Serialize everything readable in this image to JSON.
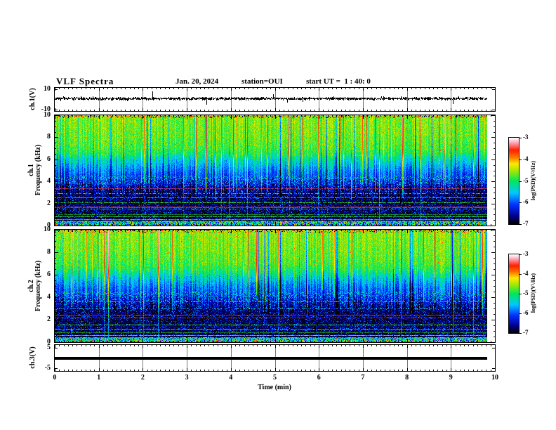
{
  "header": {
    "title": "VLF Spectra",
    "date": "Jan. 20, 2024",
    "station": "station=OUI",
    "start_ut": "start UT =  1 : 40: 0"
  },
  "axes": {
    "xlabel": "Time (min)",
    "x_ticks": [
      "0",
      "1",
      "2",
      "3",
      "4",
      "5",
      "6",
      "7",
      "8",
      "9",
      "10"
    ],
    "x_minor_per_major": 10
  },
  "panels": {
    "ch1_wave": {
      "ylabel": "ch.1(V)",
      "ytop": "10",
      "ybottom": "-10"
    },
    "spec1": {
      "ylabel_line1": "ch.1",
      "ylabel_line2": "Frequency (kHz)",
      "y_ticks": [
        "10",
        "8",
        "6",
        "4",
        "2",
        "0"
      ]
    },
    "spec2": {
      "ylabel_line1": "ch.2",
      "ylabel_line2": "Frequency (kHz)",
      "y_ticks": [
        "10",
        "8",
        "6",
        "4",
        "2",
        "0"
      ]
    },
    "ch3_wave": {
      "ylabel": "ch.3(V)",
      "ytop": "5",
      "ybottom": "-5"
    }
  },
  "colorbars": [
    {
      "label": "log(PSD)(V²/Hz)",
      "ticks": [
        "-3",
        "-4",
        "-5",
        "-6",
        "-7"
      ]
    },
    {
      "label": "log(PSD)(V²/Hz)",
      "ticks": [
        "-3",
        "-4",
        "-5",
        "-6",
        "-7"
      ]
    }
  ],
  "colormap": {
    "zlim": [
      -7,
      -3
    ],
    "stops": [
      [
        0,
        "#000000"
      ],
      [
        0.09,
        "#000090"
      ],
      [
        0.22,
        "#0030ff"
      ],
      [
        0.36,
        "#00c8ff"
      ],
      [
        0.5,
        "#00e858"
      ],
      [
        0.62,
        "#a8e800"
      ],
      [
        0.7,
        "#ffe800"
      ],
      [
        0.78,
        "#ff7000"
      ],
      [
        0.86,
        "#ff2000"
      ],
      [
        0.94,
        "#ff9cb0"
      ],
      [
        1,
        "#ffffff"
      ]
    ]
  },
  "line_feature_colors": {
    "green": [
      "#2fc428",
      "#57e437",
      "#1d8f18"
    ],
    "dkgreen": [
      "#1e8c14",
      "#166a10",
      "#2fa81e"
    ],
    "cyan": [
      "#35d8d0",
      "#28b8d8",
      "#1890c0"
    ],
    "magenta": [
      "#a838a8",
      "#c03030",
      "#602060"
    ],
    "red": [
      "#cc2424",
      "#cc2424",
      "#a83898"
    ]
  },
  "chart_data": [
    {
      "type": "line",
      "name": "ch1-voltage-timeseries",
      "xlabel": "Time (min)",
      "ylabel": "ch.1(V)",
      "xlim": [
        0,
        10
      ],
      "ylim": [
        -11.5,
        11.5
      ],
      "y_tick_values": [
        10,
        -10
      ],
      "x_tick_values": [
        0,
        1,
        2,
        3,
        4,
        5,
        6,
        7,
        8,
        9,
        10
      ],
      "data_end_min": 9.82,
      "grid_minutes": true,
      "signal": {
        "mean_v": 0.8,
        "noise_std_v": 1.0,
        "spike_prob": 0.012,
        "spike_extra_v": 4.5,
        "color": "#000000"
      }
    },
    {
      "type": "heatmap",
      "name": "ch1-spectrogram",
      "xlabel": "Time (min)",
      "ylabel": "ch.1 Frequency (kHz)",
      "zlabel": "log(PSD)(V²/Hz)",
      "xlim": [
        0,
        10
      ],
      "ylim": [
        0,
        10
      ],
      "zlim": [
        -7,
        -3
      ],
      "data_end_min": 9.82,
      "busy_band_top_khz": 0.45,
      "base_profile_khz_psd": [
        [
          0.5,
          -6.9
        ],
        [
          1,
          -6.8
        ],
        [
          1.5,
          -6.85
        ],
        [
          2,
          -6.9
        ],
        [
          2.6,
          -6.85
        ],
        [
          3,
          -6.8
        ],
        [
          3.5,
          -6.6
        ],
        [
          4,
          -6.3
        ],
        [
          4.5,
          -6.0
        ],
        [
          5,
          -5.8
        ],
        [
          5.5,
          -5.55
        ],
        [
          6,
          -5.3
        ],
        [
          6.5,
          -4.95
        ],
        [
          7,
          -4.8
        ],
        [
          8,
          -4.7
        ],
        [
          9,
          -4.65
        ],
        [
          10,
          -4.6
        ]
      ],
      "horizontal_lines": [
        {
          "khz": 4.3,
          "kind": "cyan",
          "density": 0.3
        },
        {
          "khz": 3.9,
          "kind": "cyan",
          "density": 0.4
        },
        {
          "khz": 3.4,
          "kind": "magenta",
          "density": 0.85
        },
        {
          "khz": 2.95,
          "kind": "cyan",
          "density": 0.5
        },
        {
          "khz": 2.55,
          "kind": "green",
          "density": 0.85
        },
        {
          "khz": 2.1,
          "kind": "green",
          "density": 0.8
        },
        {
          "khz": 1.75,
          "kind": "magenta",
          "density": 0.9,
          "rows": 2
        },
        {
          "khz": 1.5,
          "kind": "cyan",
          "density": 0.6
        },
        {
          "khz": 1.05,
          "kind": "dkgreen",
          "density": 0.9
        },
        {
          "khz": 0.85,
          "kind": "green",
          "density": 0.9
        },
        {
          "khz": 0.55,
          "kind": "green",
          "density": 0.95
        }
      ],
      "streaks": {
        "bright_prob": 0.055,
        "dark_prob": 0.05
      }
    },
    {
      "type": "heatmap",
      "name": "ch2-spectrogram",
      "xlabel": "Time (min)",
      "ylabel": "ch.2 Frequency (kHz)",
      "zlabel": "log(PSD)(V²/Hz)",
      "xlim": [
        0,
        10
      ],
      "ylim": [
        0,
        10
      ],
      "zlim": [
        -7,
        -3
      ],
      "data_end_min": 9.82,
      "busy_band_top_khz": 0.45,
      "base_profile_khz_psd": [
        [
          0.5,
          -6.9
        ],
        [
          1,
          -6.8
        ],
        [
          1.5,
          -6.85
        ],
        [
          2,
          -6.9
        ],
        [
          2.6,
          -6.85
        ],
        [
          3,
          -6.75
        ],
        [
          3.5,
          -6.55
        ],
        [
          4,
          -6.25
        ],
        [
          4.5,
          -6.0
        ],
        [
          5,
          -5.8
        ],
        [
          5.5,
          -5.55
        ],
        [
          6,
          -5.25
        ],
        [
          6.5,
          -4.95
        ],
        [
          7,
          -4.8
        ],
        [
          8,
          -4.7
        ],
        [
          9,
          -4.65
        ],
        [
          10,
          -4.6
        ]
      ],
      "horizontal_lines": [
        {
          "khz": 3.6,
          "kind": "cyan",
          "density": 0.5
        },
        {
          "khz": 3.0,
          "kind": "cyan",
          "density": 0.4
        },
        {
          "khz": 2.45,
          "kind": "red",
          "density": 0.95
        },
        {
          "khz": 2.2,
          "kind": "magenta",
          "density": 0.8
        },
        {
          "khz": 1.55,
          "kind": "green",
          "density": 0.9
        },
        {
          "khz": 1.2,
          "kind": "green",
          "density": 0.85
        },
        {
          "khz": 0.9,
          "kind": "dkgreen",
          "density": 0.9
        },
        {
          "khz": 0.65,
          "kind": "green",
          "density": 0.95
        },
        {
          "khz": 0.35,
          "kind": "cyan",
          "density": 0.7
        }
      ],
      "streaks": {
        "bright_prob": 0.055,
        "dark_prob": 0.05
      }
    },
    {
      "type": "line",
      "name": "ch3-voltage-timeseries",
      "xlabel": "Time (min)",
      "ylabel": "ch.3(V)",
      "xlim": [
        0,
        10
      ],
      "ylim": [
        -6.5,
        6.5
      ],
      "y_tick_values": [
        5,
        -5
      ],
      "x_tick_values": [
        0,
        1,
        2,
        3,
        4,
        5,
        6,
        7,
        8,
        9,
        10
      ],
      "data_end_min": 9.82,
      "grid_minutes": true,
      "signal": {
        "flat_value_v": 0,
        "thickness_px": 4,
        "color": "#000000"
      }
    }
  ]
}
